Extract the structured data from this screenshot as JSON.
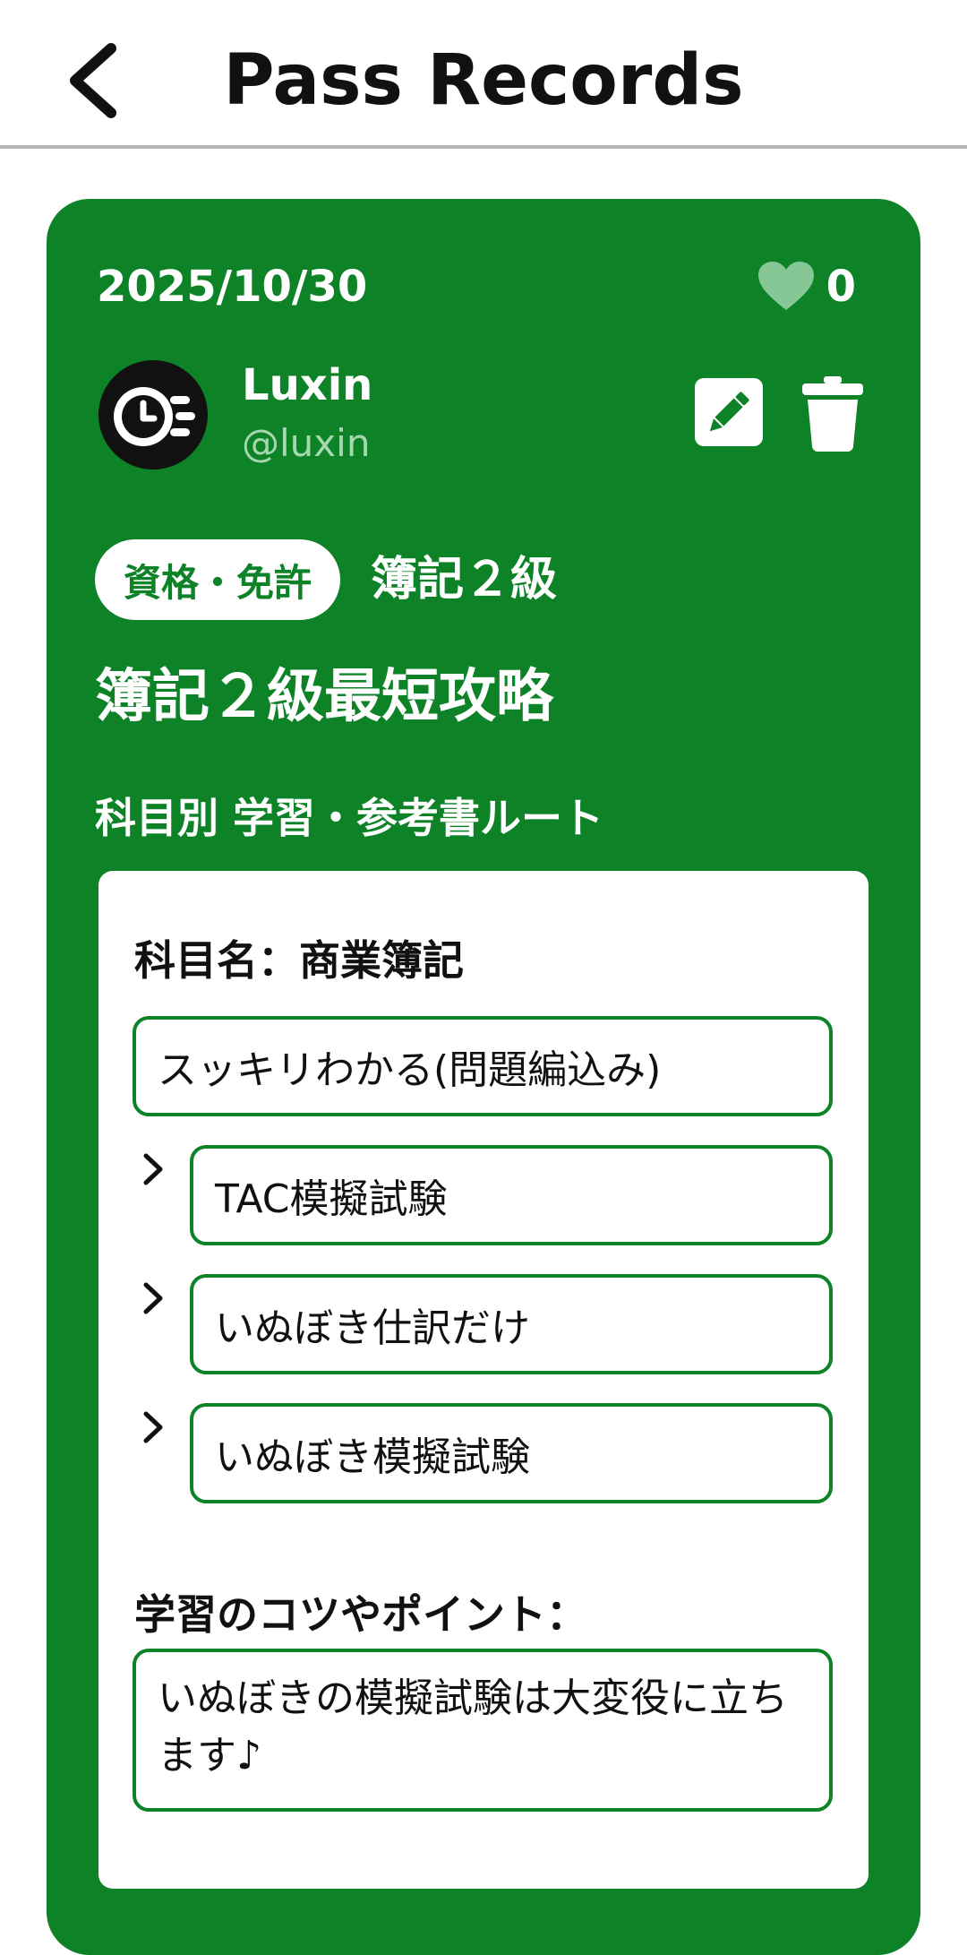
{
  "header": {
    "title": "Pass Records",
    "back_icon": "chevron-left-icon"
  },
  "post": {
    "date": "2025/10/30",
    "likes": "0",
    "heart_icon": "heart-icon",
    "user": {
      "name": "Luxin",
      "handle": "@luxin",
      "avatar_icon": "clock-speed-avatar"
    },
    "actions": {
      "edit_icon": "pencil-icon",
      "delete_icon": "trash-icon"
    },
    "category": "資格・免許",
    "qualification": "簿記２級",
    "title": "簿記２級最短攻略",
    "route_heading": "科目別 学習・参考書ルート",
    "subject": {
      "label": "科目名：商業簿記",
      "books": [
        "スッキリわかる(問題編込み)",
        "TAC模擬試験",
        "いぬぼき仕訳だけ",
        "いぬぼき模擬試験"
      ]
    },
    "tips_label": "学習のコツやポイント：",
    "tips_line1": "いぬぼきの模擬試験は大変役に立ち",
    "tips_line2": "ます♪"
  },
  "colors": {
    "card_green": "#0d8227",
    "heart_green": "#86c795",
    "handle_green": "#a6d8b0",
    "divider": "#b4b4b4"
  }
}
